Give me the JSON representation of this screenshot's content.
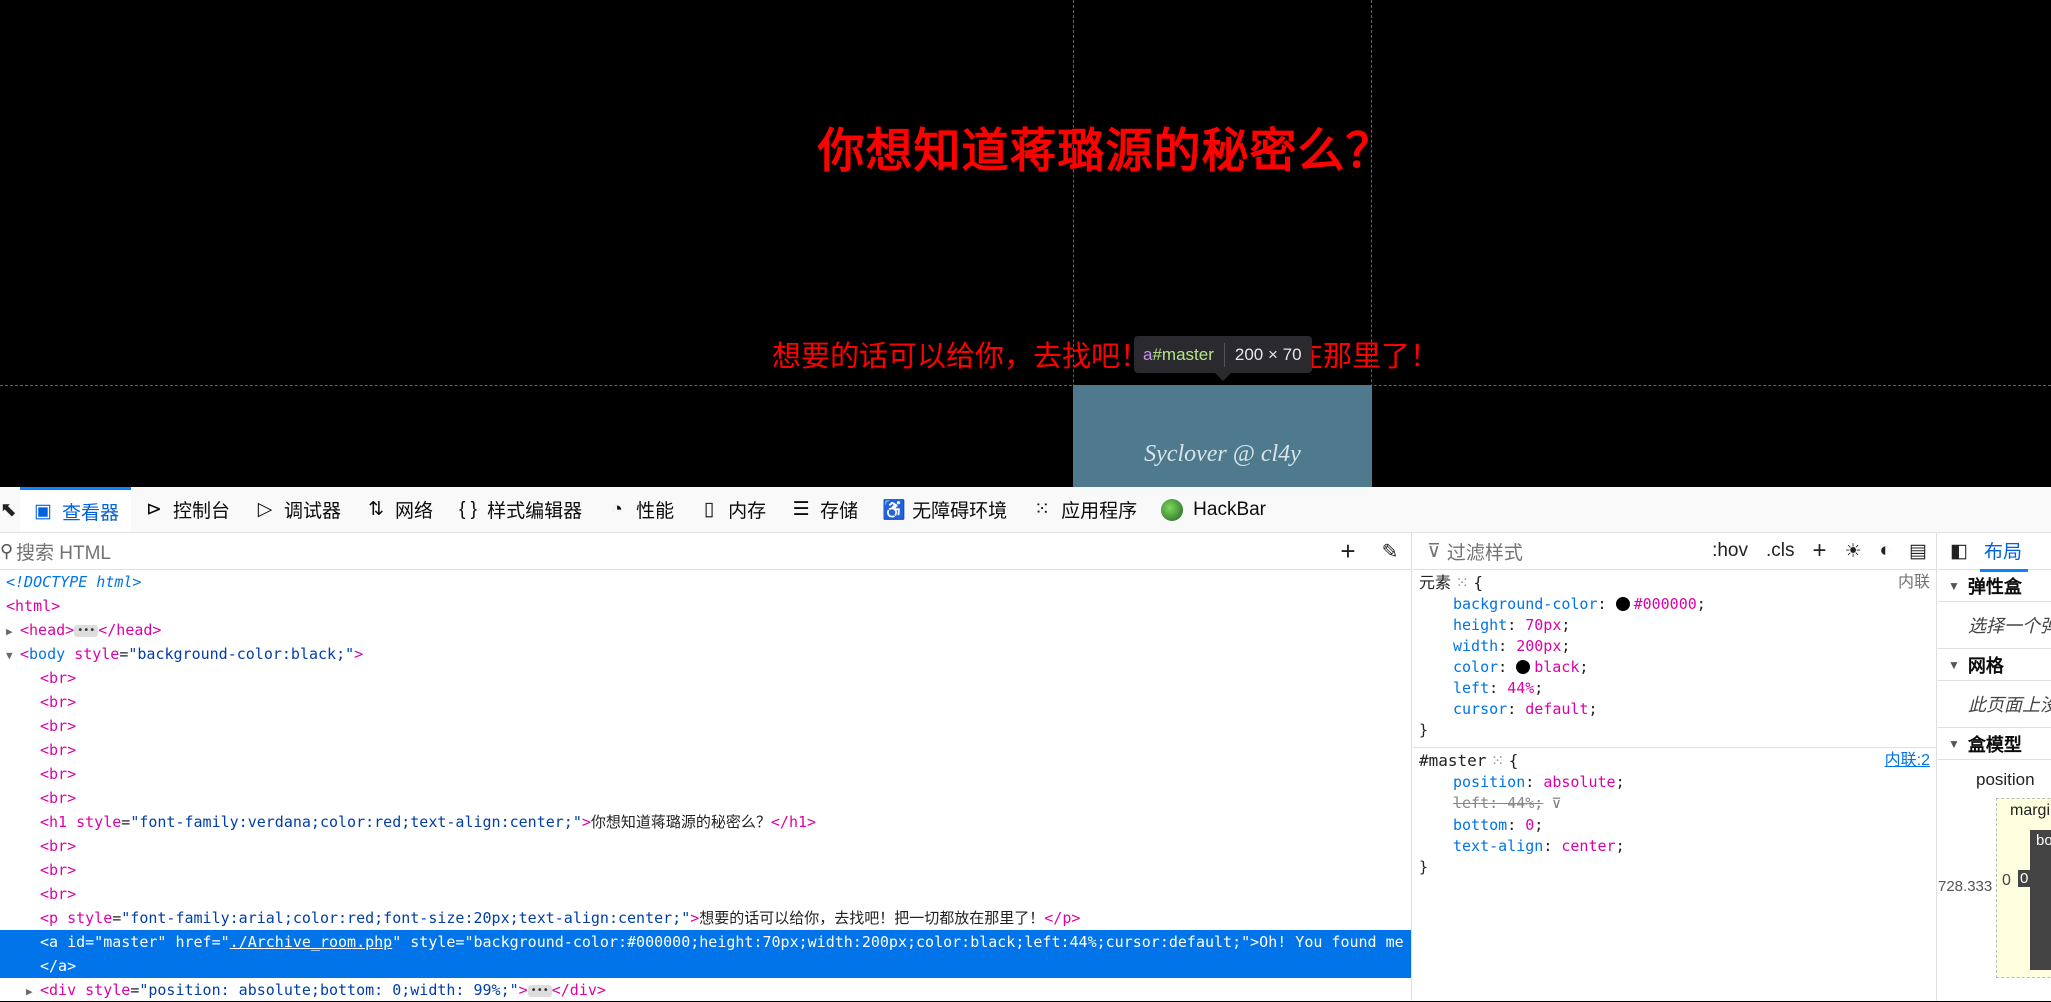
{
  "page": {
    "heading": "你想知道蒋璐源的秘密么？",
    "paragraph": "想要的话可以给你，去找吧！把一切都放在那里了！",
    "master_link_text": "Syclover @ cl4y",
    "tooltip": {
      "tag": "a",
      "id": "#master",
      "dims": "200 × 70"
    },
    "colors": {
      "heading": "#ff0000",
      "master_box": "#4f7a8e",
      "highlight": "#0074e8"
    }
  },
  "devtools": {
    "tabs": [
      {
        "label": "查看器",
        "icon": "inspector-icon",
        "glyph": "▣",
        "active": true
      },
      {
        "label": "控制台",
        "icon": "console-icon",
        "glyph": "⊳"
      },
      {
        "label": "调试器",
        "icon": "debugger-icon",
        "glyph": "▷"
      },
      {
        "label": "网络",
        "icon": "network-icon",
        "glyph": "⇅"
      },
      {
        "label": "样式编辑器",
        "icon": "style-editor-icon",
        "glyph": "{ }"
      },
      {
        "label": "性能",
        "icon": "performance-icon",
        "glyph": "◔"
      },
      {
        "label": "内存",
        "icon": "memory-icon",
        "glyph": "▯"
      },
      {
        "label": "存储",
        "icon": "storage-icon",
        "glyph": "☰"
      },
      {
        "label": "无障碍环境",
        "icon": "accessibility-icon",
        "glyph": "♿"
      },
      {
        "label": "应用程序",
        "icon": "application-icon",
        "glyph": "⁙"
      },
      {
        "label": "HackBar",
        "icon": "hackbar-icon",
        "glyph": ""
      }
    ],
    "html_search_placeholder": "搜索 HTML",
    "html_tree": {
      "doctype": "<!DOCTYPE html>",
      "html_open": "<html>",
      "head": "<head>",
      "head_close": "</head>",
      "body_tag": "body",
      "body_attr_name": "style",
      "body_attr_value": "\"background-color:black;\"",
      "br": "<br>",
      "h1_attr_value": "\"font-family:verdana;color:red;text-align:center;\"",
      "h1_text": "你想知道蒋璐源的秘密么？",
      "p_attr_value": "\"font-family:arial;color:red;font-size:20px;text-align:center;\"",
      "p_text": "想要的话可以给你，去找吧！把一切都放在那里了！",
      "a_line": "<a id=\"master\" href=\"",
      "a_href": "./Archive_room.php",
      "a_rest": "\" style=\"background-color:#000000;height:70px;width:200px;color:black;left:44%;cursor:default;\">Oh! You found me",
      "a_close": "</a>",
      "div_attr_value": "\"position: absolute;bottom: 0;width: 99%;\"",
      "div_close": "</div>"
    },
    "rules_filter_placeholder": "过滤样式",
    "rules_buttons": {
      "hov": ":hov",
      "cls": ".cls",
      "add": "+"
    },
    "rules": [
      {
        "selector": "元素",
        "source": "内联",
        "decls": [
          {
            "prop": "background-color",
            "value": "#000000",
            "swatch": true
          },
          {
            "prop": "height",
            "value": "70px"
          },
          {
            "prop": "width",
            "value": "200px"
          },
          {
            "prop": "color",
            "value": "black",
            "swatch": true
          },
          {
            "prop": "left",
            "value": "44%"
          },
          {
            "prop": "cursor",
            "value": "default"
          }
        ]
      },
      {
        "selector": "#master",
        "source": "内联:2",
        "decls": [
          {
            "prop": "position",
            "value": "absolute"
          },
          {
            "prop": "left",
            "value": "44%",
            "overridden": true
          },
          {
            "prop": "bottom",
            "value": "0"
          },
          {
            "prop": "text-align",
            "value": "center"
          }
        ]
      }
    ],
    "layout": {
      "tab": "布局",
      "flexbox_title": "弹性盒",
      "flexbox_hint": "选择一个弹性",
      "grid_title": "网格",
      "grid_hint": "此页面上没",
      "boxmodel_title": "盒模型",
      "position_label": "position",
      "margin_label": "margin",
      "border_label": "bo",
      "value": "728.333",
      "zero": "0"
    }
  }
}
